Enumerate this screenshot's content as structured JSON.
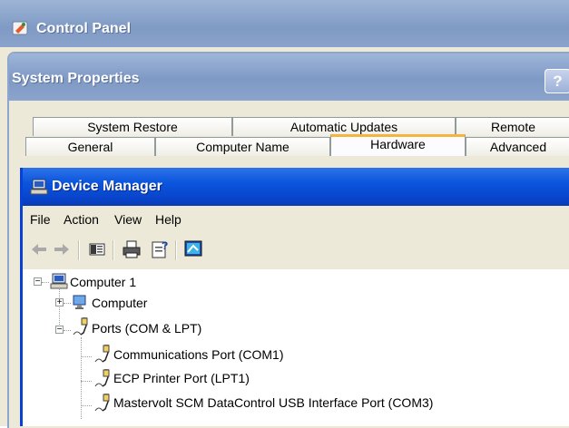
{
  "control_panel": {
    "title": "Control Panel"
  },
  "system_properties": {
    "title": "System Properties",
    "help_label": "?",
    "tabs_row1": [
      "System Restore",
      "Automatic Updates",
      "Remote"
    ],
    "tabs_row2": [
      "General",
      "Computer Name",
      "Hardware",
      "Advanced"
    ],
    "active_tab": "Hardware"
  },
  "device_manager": {
    "title": "Device Manager",
    "menu": [
      "File",
      "Action",
      "View",
      "Help"
    ],
    "toolbar": [
      "back-arrow-icon",
      "forward-arrow-icon",
      "show-hide-console-tree-icon",
      "print-icon",
      "properties-help-icon",
      "computer-scan-icon"
    ],
    "tree": {
      "root": "Computer 1",
      "computer": "Computer",
      "ports": "Ports (COM & LPT)",
      "ports_children": [
        "Communications Port (COM1)",
        "ECP Printer Port (LPT1)",
        "Mastervolt SCM DataControl USB Interface Port (COM3)"
      ]
    }
  },
  "colors": {
    "xp_blue_title": "#0a55dd",
    "inactive_title": "#8aa3cc",
    "active_tab_accent": "#f6b33d",
    "window_face": "#ece9d8"
  }
}
